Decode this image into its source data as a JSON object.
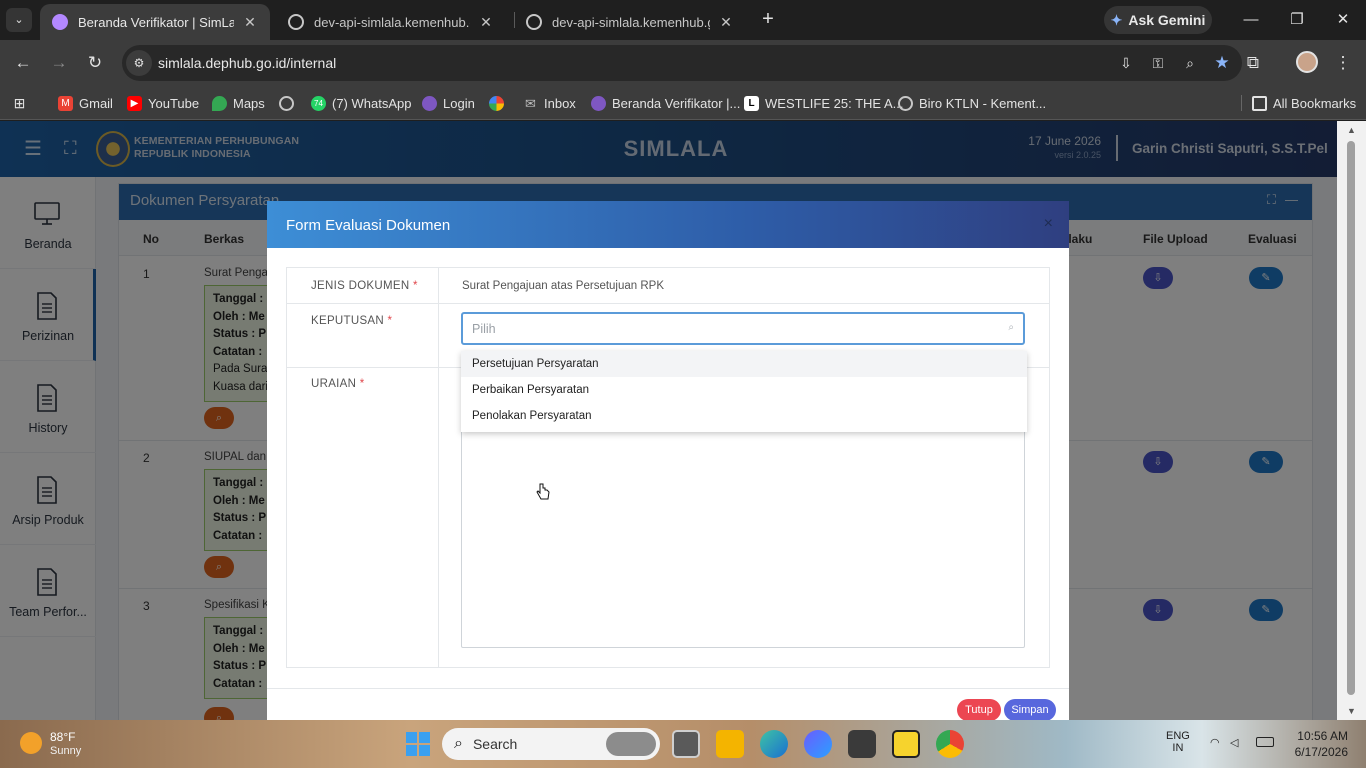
{
  "browser": {
    "tabs": [
      {
        "title": "Beranda Verifikator | SimLala",
        "active": true
      },
      {
        "title": "dev-api-simlala.kemenhub.go.id",
        "active": false
      },
      {
        "title": "dev-api-simlala.kemenhub.go.id",
        "active": false
      }
    ],
    "gemini_label": "Ask Gemini",
    "url": "simlala.dephub.go.id/internal",
    "bookmarks": [
      {
        "label": "Gmail",
        "icon": "gmail-icon",
        "color": "#ea4335"
      },
      {
        "label": "YouTube",
        "icon": "youtube-icon",
        "color": "#ff0000"
      },
      {
        "label": "Maps",
        "icon": "maps-icon",
        "color": "#34a853"
      },
      {
        "label": "",
        "icon": "globe-icon",
        "color": "#9aa0a6"
      },
      {
        "label": "(7) WhatsApp",
        "icon": "whatsapp-icon",
        "color": "#25d366",
        "badge": "74"
      },
      {
        "label": "Login",
        "icon": "login-icon",
        "color": "#b388ff"
      },
      {
        "label": "",
        "icon": "pinwheel-icon",
        "color": "#fbbc04"
      },
      {
        "label": "Inbox",
        "icon": "mail-icon",
        "color": "#bdbdbd"
      },
      {
        "label": "Beranda Verifikator |...",
        "icon": "simlala-icon",
        "color": "#b388ff"
      },
      {
        "label": "WESTLIFE 25: THE A...",
        "icon": "letter-l-icon",
        "color": "#ffffff"
      },
      {
        "label": "Biro KTLN - Kement...",
        "icon": "globe-icon",
        "color": "#9aa0a6"
      }
    ],
    "all_bookmarks_label": "All Bookmarks"
  },
  "app": {
    "ministry_line1": "KEMENTERIAN PERHUBUNGAN",
    "ministry_line2": "REPUBLIK INDONESIA",
    "brand": "SIMLALA",
    "date": "17 June 2026",
    "version": "versi 2.0.25",
    "user": "Garin Christi Saputri, S.S.T.Pel",
    "sidebar": [
      {
        "label": "Beranda",
        "icon": "monitor-icon"
      },
      {
        "label": "Perizinan",
        "icon": "document-icon",
        "active": true
      },
      {
        "label": "History",
        "icon": "document-icon"
      },
      {
        "label": "Arsip Produk",
        "icon": "document-icon"
      },
      {
        "label": "Team Perfor...",
        "icon": "document-icon"
      }
    ],
    "card": {
      "title": "Dokumen Persyaratan",
      "columns": [
        "No",
        "Berkas",
        "Berlaku",
        "File Upload",
        "Evaluasi"
      ],
      "berlaku_visible": "erlaku",
      "rows": [
        {
          "no": "1",
          "berkas": "Surat Pengaj",
          "details": [
            "Tanggal :",
            "Oleh : Me",
            "Status : P",
            "Catatan :",
            "Pada Surat",
            "Kuasa dari"
          ]
        },
        {
          "no": "2",
          "berkas": "SIUPAL dan E",
          "details": [
            "Tanggal :",
            "Oleh : Me",
            "Status : P",
            "Catatan :"
          ]
        },
        {
          "no": "3",
          "berkas": "Spesifikasi Ka",
          "details": [
            "Tanggal :",
            "Oleh : Me",
            "Status : P",
            "Catatan :"
          ]
        }
      ]
    }
  },
  "modal": {
    "title": "Form Evaluasi Dokumen",
    "close": "×",
    "fields": {
      "jenis_label": "JENIS DOKUMEN",
      "jenis_value": "Surat Pengajuan atas Persetujuan RPK",
      "keputusan_label": "KEPUTUSAN",
      "keputusan_placeholder": "Pilih",
      "uraian_label": "URAIAN",
      "required_mark": "*"
    },
    "options": [
      "Persetujuan Persyaratan",
      "Perbaikan Persyaratan",
      "Penolakan Persyaratan"
    ],
    "hovered_option": 0,
    "buttons": {
      "tutup": "Tutup",
      "simpan": "Simpan"
    }
  },
  "taskbar": {
    "temp": "88°F",
    "condition": "Sunny",
    "search": "Search",
    "lang1": "ENG",
    "lang2": "IN",
    "time": "10:56 AM",
    "date": "6/17/2026"
  }
}
